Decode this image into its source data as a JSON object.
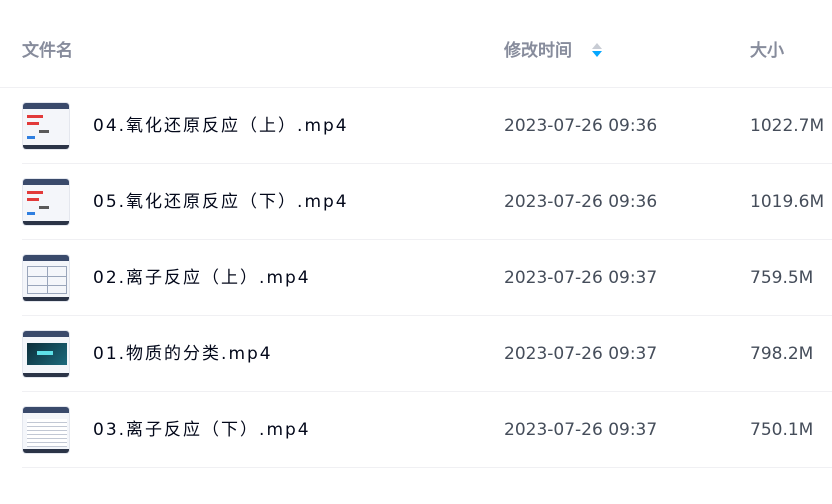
{
  "header": {
    "name_label": "文件名",
    "mtime_label": "修改时间",
    "size_label": "大小",
    "sort_icon": "sort-desc-icon",
    "sort_active_color": "#06a7ff"
  },
  "files": [
    {
      "name": "04.氧化还原反应（上）.mp4",
      "mtime": "2023-07-26 09:36",
      "size": "1022.7M",
      "thumb": "video-thumbnail"
    },
    {
      "name": "05.氧化还原反应（下）.mp4",
      "mtime": "2023-07-26 09:36",
      "size": "1019.6M",
      "thumb": "video-thumbnail"
    },
    {
      "name": "02.离子反应（上）.mp4",
      "mtime": "2023-07-26 09:37",
      "size": "759.5M",
      "thumb": "video-thumbnail"
    },
    {
      "name": "01.物质的分类.mp4",
      "mtime": "2023-07-26 09:37",
      "size": "798.2M",
      "thumb": "video-thumbnail"
    },
    {
      "name": "03.离子反应（下）.mp4",
      "mtime": "2023-07-26 09:37",
      "size": "750.1M",
      "thumb": "video-thumbnail"
    }
  ]
}
